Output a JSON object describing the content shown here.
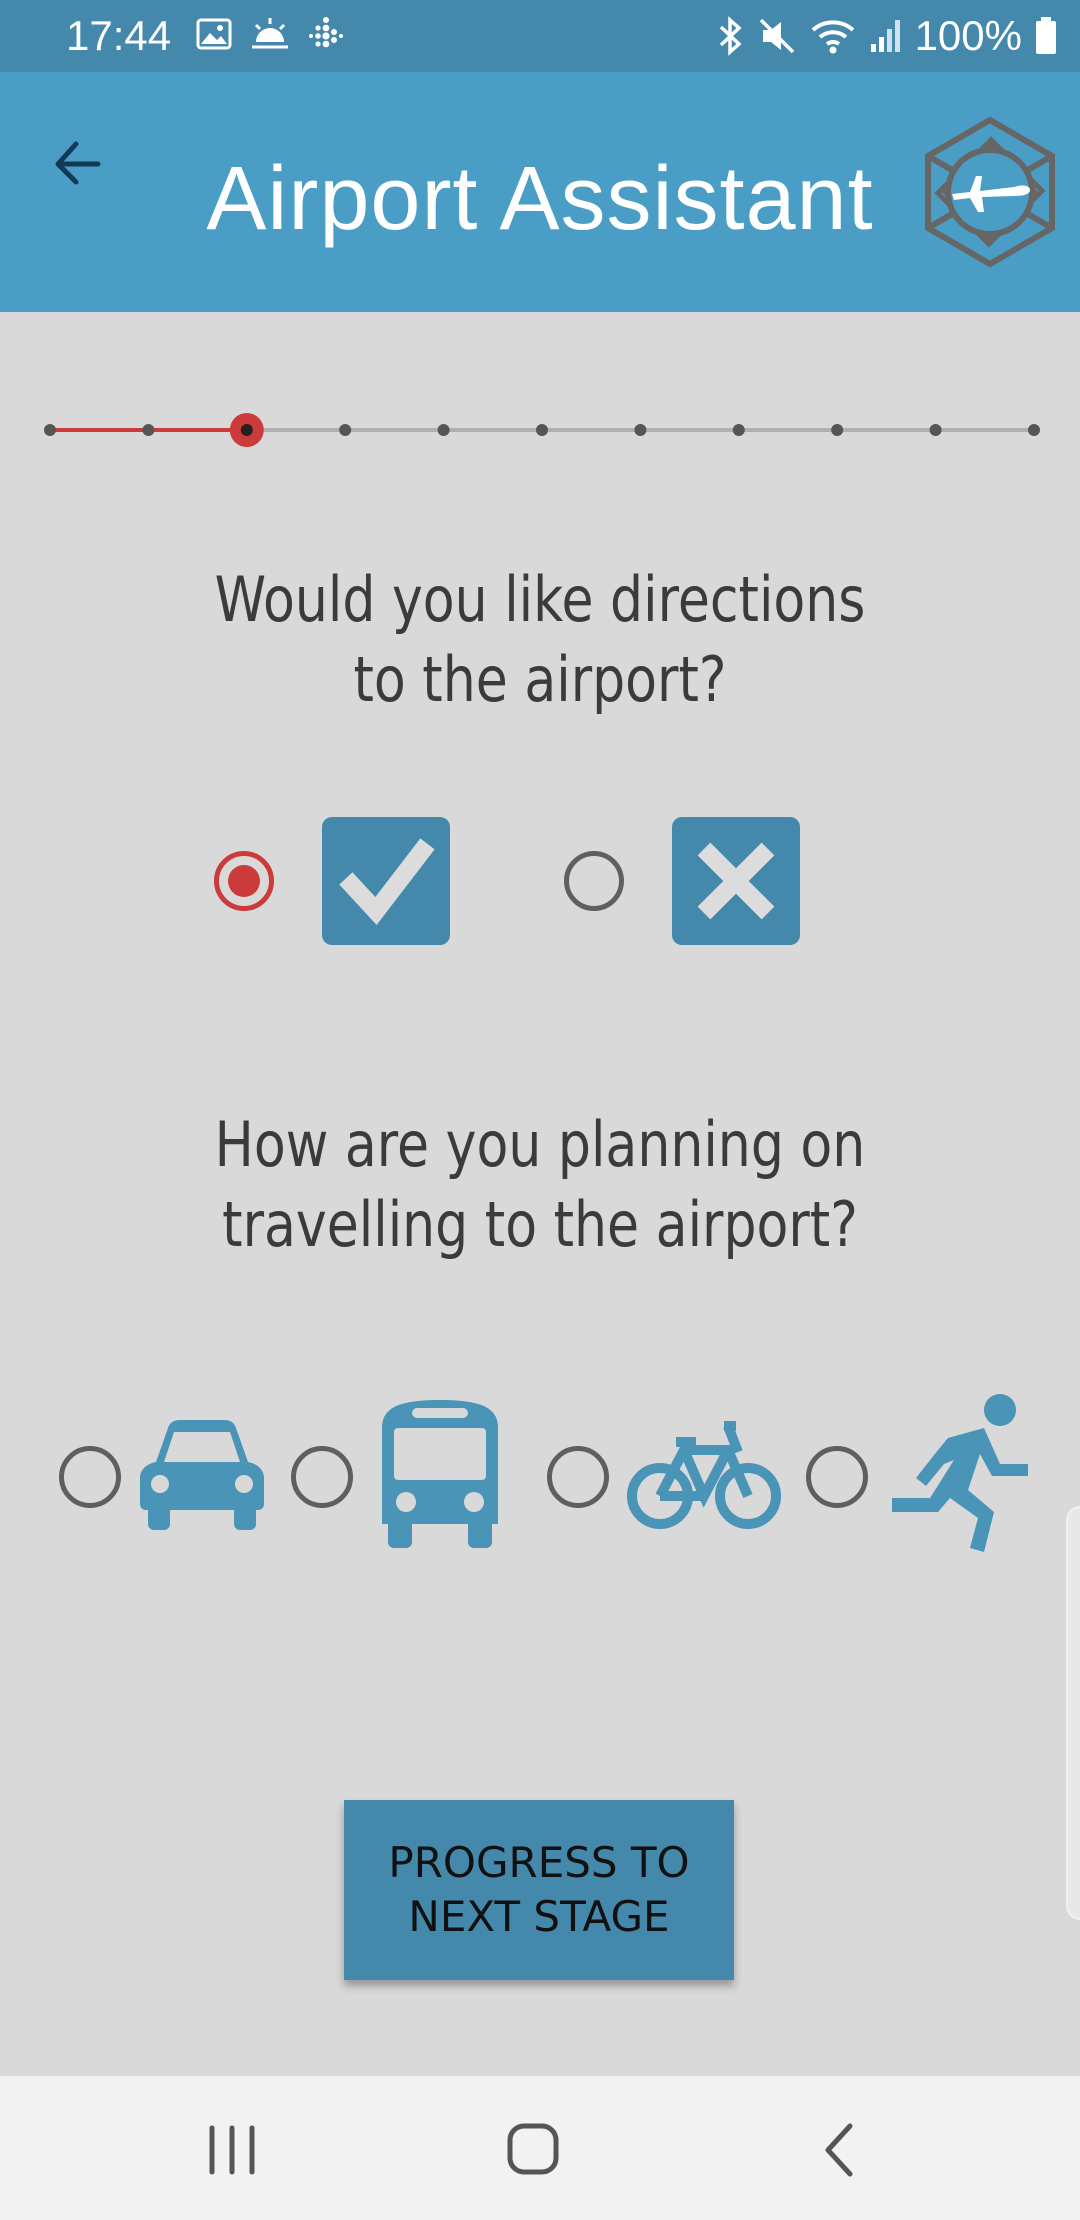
{
  "status_bar": {
    "time": "17:44",
    "battery": "100%",
    "left_icons": [
      "image-icon",
      "weather-icon",
      "fitbit-icon"
    ],
    "right_icons": [
      "bluetooth-icon",
      "mute-icon",
      "wifi-icon",
      "signal-icon",
      "battery-icon"
    ]
  },
  "app_bar": {
    "title": "Airport Assistant",
    "back_icon": "arrow-left-icon",
    "logo_icon": "airplane-hexagon-logo"
  },
  "progress": {
    "total_steps": 11,
    "current_step": 3,
    "completed_color": "#cc3b3b",
    "pending_color": "#b0b0b0"
  },
  "question1": {
    "line1": "Would you like directions",
    "line2": "to the airport?",
    "options": [
      {
        "id": "yes",
        "icon": "checkmark-icon",
        "selected": true
      },
      {
        "id": "no",
        "icon": "cross-icon",
        "selected": false
      }
    ]
  },
  "question2": {
    "line1": "How are you planning on",
    "line2": "travelling to the airport?",
    "options": [
      {
        "id": "car",
        "icon": "car-icon",
        "selected": false
      },
      {
        "id": "bus",
        "icon": "bus-icon",
        "selected": false
      },
      {
        "id": "bike",
        "icon": "bicycle-icon",
        "selected": false
      },
      {
        "id": "walk",
        "icon": "running-icon",
        "selected": false
      }
    ]
  },
  "next_button": {
    "label": "PROGRESS TO NEXT STAGE"
  },
  "nav_bar": {
    "icons": [
      "recent-apps-icon",
      "home-icon",
      "back-icon"
    ]
  },
  "colors": {
    "app_bar": "#4a9ec6",
    "status_bar": "#4488ac",
    "accent": "#4488ac",
    "selected_radio": "#cc3b3b",
    "background": "#d9d9d9"
  }
}
